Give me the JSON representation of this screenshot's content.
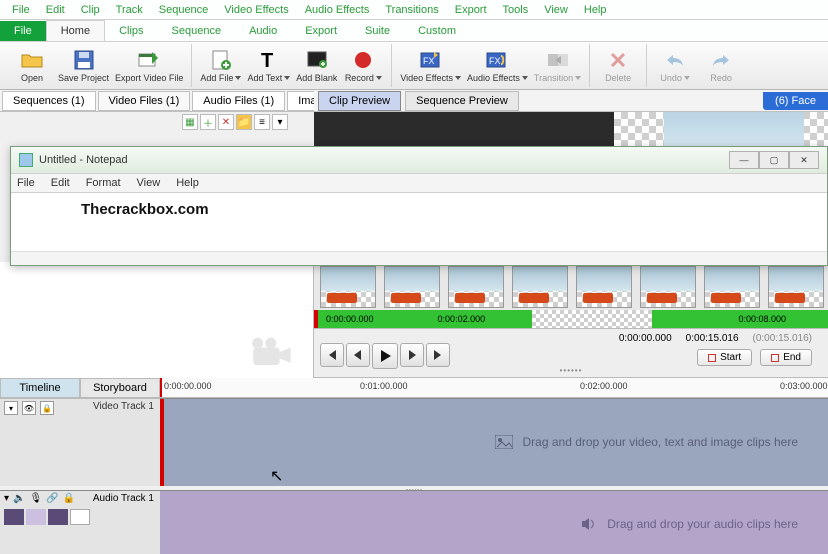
{
  "menubar": [
    "File",
    "Edit",
    "Clip",
    "Track",
    "Sequence",
    "Video Effects",
    "Audio Effects",
    "Transitions",
    "Export",
    "Tools",
    "View",
    "Help"
  ],
  "ribbon_tabs": {
    "file": "File",
    "home": "Home",
    "clips": "Clips",
    "sequence": "Sequence",
    "audio": "Audio",
    "export": "Export",
    "suite": "Suite",
    "custom": "Custom"
  },
  "ribbon": {
    "open": "Open",
    "save": "Save Project",
    "export_vf": "Export Video File",
    "add_file": "Add File",
    "add_text": "Add Text",
    "add_blank": "Add Blank",
    "record": "Record",
    "vfx": "Video Effects",
    "afx": "Audio Effects",
    "transition": "Transition",
    "delete": "Delete",
    "undo": "Undo",
    "redo": "Redo"
  },
  "subtabs": {
    "sequences": "Sequences (1)",
    "video_files": "Video Files (1)",
    "audio_files": "Audio Files (1)",
    "image": "Image"
  },
  "preview_tabs": {
    "clip": "Clip Preview",
    "sequence": "Sequence Preview",
    "right": "(6) Face"
  },
  "notepad": {
    "title": "Untitled - Notepad",
    "menu": [
      "File",
      "Edit",
      "Format",
      "View",
      "Help"
    ],
    "body": "Thecrackbox.com"
  },
  "seq_times": {
    "t0": "0:00:00.000",
    "t1": "0:00:02.000",
    "t2": "0:00:08.000"
  },
  "player": {
    "start": "Start",
    "end": "End",
    "cur": "0:00:00.000",
    "pos": "0:00:15.016",
    "dur": "(0:00:15.016)"
  },
  "timeline_tabs": {
    "timeline": "Timeline",
    "storyboard": "Storyboard"
  },
  "ruler": {
    "t0": "0:00:00.000",
    "t1": "0:01:00.000",
    "t2": "0:02:00.000",
    "t3": "0:03:00.000"
  },
  "tracks": {
    "video": "Video Track 1",
    "video_drop": "Drag and drop your video, text and image clips here",
    "audio": "Audio Track 1",
    "audio_drop": "Drag and drop your audio clips here"
  }
}
